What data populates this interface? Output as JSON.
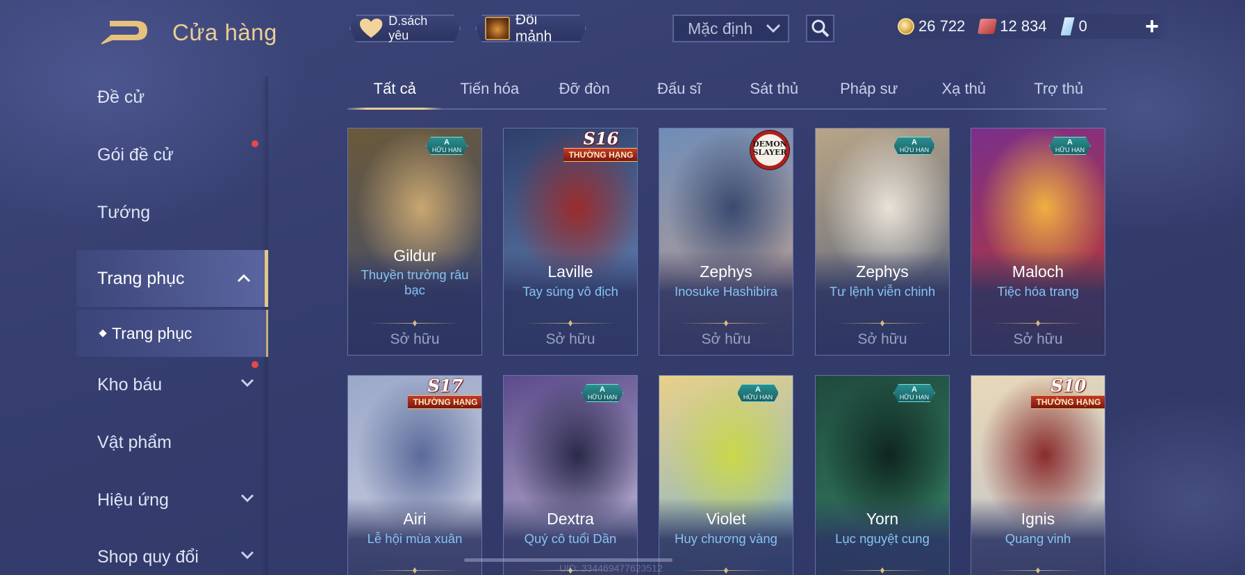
{
  "header": {
    "title": "Cửa hàng",
    "favorites_label": "D.sách yêu",
    "shards_label": "Đổi mảnh",
    "sort_value": "Mặc định"
  },
  "currencies": [
    {
      "name": "coin-icon",
      "value": "26 722"
    },
    {
      "name": "voucher-icon",
      "value": "12 834"
    },
    {
      "name": "gem-icon",
      "value": "0"
    }
  ],
  "sidebar": {
    "items": [
      {
        "label": "Đề cử"
      },
      {
        "label": "Gói đề cử"
      },
      {
        "label": "Tướng"
      },
      {
        "label": "Trang phục"
      },
      {
        "label": "Kho báu"
      },
      {
        "label": "Vật phẩm"
      },
      {
        "label": "Hiệu ứng"
      },
      {
        "label": "Shop quy đổi"
      }
    ],
    "sub_item": "Trang phục"
  },
  "tabs": [
    "Tất cả",
    "Tiến hóa",
    "Đỡ đòn",
    "Đấu sĩ",
    "Sát thủ",
    "Pháp sư",
    "Xạ thủ",
    "Trợ thủ"
  ],
  "badge_text": {
    "a_rank": "A",
    "unlimited": "HỮU HẠN",
    "ranked": "THƯỜNG HẠNG",
    "demon_slayer": "DEMON SLAYER"
  },
  "cards": [
    {
      "hero": "Gildur",
      "skin": "Thuyền trưởng râu bạc",
      "status": "Sở hữu",
      "badge": "A",
      "colors": [
        "#6b5a3a",
        "#3a4a7a",
        "#c9a770"
      ]
    },
    {
      "hero": "Laville",
      "skin": "Tay súng vô địch",
      "status": "Sở hữu",
      "badge": "S16",
      "colors": [
        "#2e3e6a",
        "#6c8fc0",
        "#9a2c2c"
      ]
    },
    {
      "hero": "Zephys",
      "skin": "Inosuke Hashibira",
      "status": "Sở hữu",
      "badge": "DS",
      "colors": [
        "#6f8db8",
        "#c8a08a",
        "#3a4a70"
      ]
    },
    {
      "hero": "Zephys",
      "skin": "Tư lệnh viễn chinh",
      "status": "Sở hữu",
      "badge": "A",
      "colors": [
        "#b9a588",
        "#4a5a7a",
        "#e8e2d8"
      ]
    },
    {
      "hero": "Maloch",
      "skin": "Tiệc hóa trang",
      "status": "Sở hữu",
      "badge": "A",
      "colors": [
        "#7a2f8a",
        "#c23a2a",
        "#f0b040"
      ]
    },
    {
      "hero": "Airi",
      "skin": "Lễ hội mùa xuân",
      "status": "",
      "badge": "S17",
      "colors": [
        "#9aa8c8",
        "#d8d8e8",
        "#5a6a9a"
      ]
    },
    {
      "hero": "Dextra",
      "skin": "Quý cô tuổi Dần",
      "status": "",
      "badge": "A",
      "colors": [
        "#5a4a8a",
        "#d8d0e8",
        "#2a2a4a"
      ]
    },
    {
      "hero": "Violet",
      "skin": "Huy chương vàng",
      "status": "",
      "badge": "A",
      "colors": [
        "#e8d088",
        "#6fb0d8",
        "#c9d84a"
      ]
    },
    {
      "hero": "Yorn",
      "skin": "Lục nguyệt cung",
      "status": "",
      "badge": "A",
      "colors": [
        "#1f4a3e",
        "#3a8a6a",
        "#0e2620"
      ]
    },
    {
      "hero": "Ignis",
      "skin": "Quang vinh",
      "status": "",
      "badge": "S10",
      "colors": [
        "#e8d8b8",
        "#b8c0d0",
        "#8a2c2c"
      ]
    }
  ],
  "uid": "UID: 334469477623512"
}
